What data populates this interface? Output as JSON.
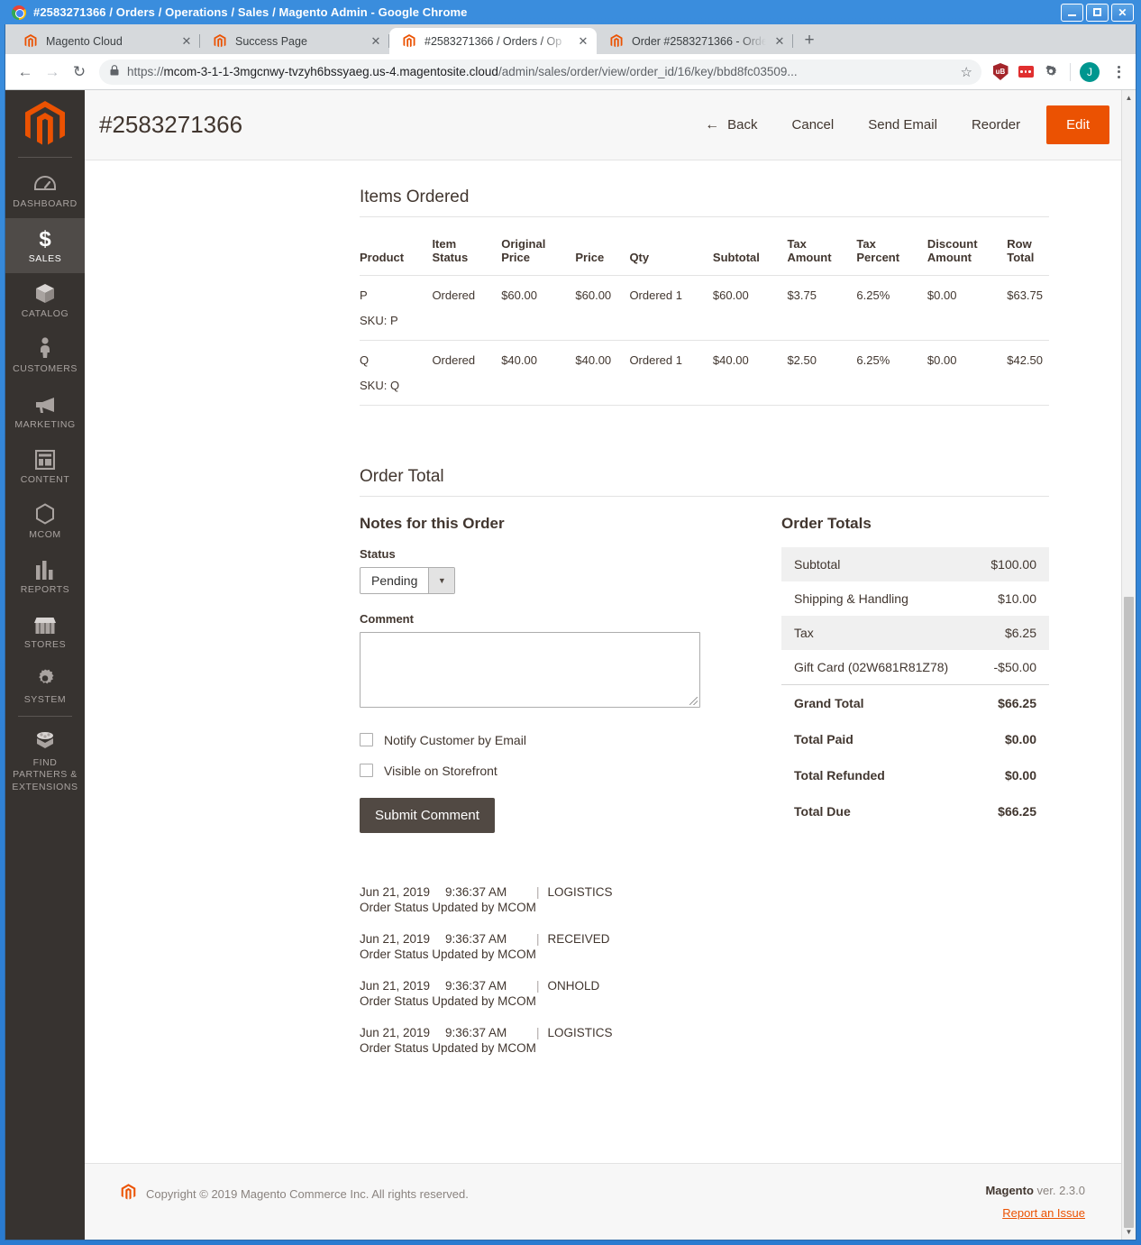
{
  "window": {
    "title": "#2583271366 / Orders / Operations / Sales / Magento Admin - Google Chrome",
    "minimize_label": "Minimize",
    "maximize_label": "Maximize",
    "close_label": "Close"
  },
  "browser": {
    "tabs": [
      {
        "label": "Magento Cloud",
        "close": "✕",
        "active": false
      },
      {
        "label": "Success Page",
        "close": "✕",
        "active": false
      },
      {
        "label": "#2583271366 / Orders / Op",
        "close": "✕",
        "active": true
      },
      {
        "label": "Order #2583271366 - Orde",
        "close": "✕",
        "active": false
      }
    ],
    "new_tab": "+",
    "back": "←",
    "forward": "→",
    "reload": "↻",
    "lock": "🔒",
    "url_scheme": "https://",
    "url_host": "mcom-3-1-1-3mgcnwy-tvzyh6bssyaeg.us-4.magentosite.cloud",
    "url_path": "/admin/sales/order/view/order_id/16/key/bbd8fc03509...",
    "star": "☆",
    "ublock_label": "uB",
    "avatar_initial": "J"
  },
  "sidebar": {
    "logo_name": "magento-logo",
    "items": [
      {
        "label": "DASHBOARD",
        "icon": "dashboard-icon",
        "active": false
      },
      {
        "label": "SALES",
        "icon": "dollar-icon",
        "active": true
      },
      {
        "label": "CATALOG",
        "icon": "box-icon",
        "active": false
      },
      {
        "label": "CUSTOMERS",
        "icon": "person-icon",
        "active": false
      },
      {
        "label": "MARKETING",
        "icon": "megaphone-icon",
        "active": false
      },
      {
        "label": "CONTENT",
        "icon": "layout-icon",
        "active": false
      },
      {
        "label": "MCOM",
        "icon": "hexagon-icon",
        "active": false
      },
      {
        "label": "REPORTS",
        "icon": "bar-chart-icon",
        "active": false
      },
      {
        "label": "STORES",
        "icon": "store-icon",
        "active": false
      },
      {
        "label": "SYSTEM",
        "icon": "gear-icon",
        "active": false
      },
      {
        "label": "FIND PARTNERS & EXTENSIONS",
        "icon": "extension-icon",
        "active": false
      }
    ]
  },
  "page": {
    "title": "#2583271366",
    "actions": {
      "back": "Back",
      "back_arrow": "←",
      "cancel": "Cancel",
      "send_email": "Send Email",
      "reorder": "Reorder",
      "edit": "Edit"
    }
  },
  "items_ordered": {
    "title": "Items Ordered",
    "columns": [
      "Product",
      "Item Status",
      "Original Price",
      "Price",
      "Qty",
      "Subtotal",
      "Tax Amount",
      "Tax Percent",
      "Discount Amount",
      "Row Total"
    ],
    "rows": [
      {
        "product": "P",
        "sku": "SKU: P",
        "item_status": "Ordered",
        "original_price": "$60.00",
        "price": "$60.00",
        "qty": "Ordered 1",
        "subtotal": "$60.00",
        "tax_amount": "$3.75",
        "tax_percent": "6.25%",
        "discount_amount": "$0.00",
        "row_total": "$63.75"
      },
      {
        "product": "Q",
        "sku": "SKU: Q",
        "item_status": "Ordered",
        "original_price": "$40.00",
        "price": "$40.00",
        "qty": "Ordered 1",
        "subtotal": "$40.00",
        "tax_amount": "$2.50",
        "tax_percent": "6.25%",
        "discount_amount": "$0.00",
        "row_total": "$42.50"
      }
    ]
  },
  "order_total": {
    "title": "Order Total",
    "notes": {
      "title": "Notes for this Order",
      "status_label": "Status",
      "status_value": "Pending",
      "status_arrow": "▼",
      "comment_label": "Comment",
      "comment_value": "",
      "comment_placeholder": "",
      "notify_label": "Notify Customer by Email",
      "visible_label": "Visible on Storefront",
      "submit_label": "Submit Comment"
    },
    "totals": {
      "title": "Order Totals",
      "rows": [
        {
          "label": "Subtotal",
          "amount": "$100.00",
          "shade": true,
          "strong": false
        },
        {
          "label": "Shipping & Handling",
          "amount": "$10.00",
          "shade": false,
          "strong": false
        },
        {
          "label": "Tax",
          "amount": "$6.25",
          "shade": true,
          "strong": false
        },
        {
          "label": "Gift Card (02W681R81Z78)",
          "amount": "-$50.00",
          "shade": false,
          "strong": false
        },
        {
          "label": "Grand Total",
          "amount": "$66.25",
          "shade": false,
          "strong": true
        },
        {
          "label": "Total Paid",
          "amount": "$0.00",
          "shade": false,
          "strong": true
        },
        {
          "label": "Total Refunded",
          "amount": "$0.00",
          "shade": false,
          "strong": true
        },
        {
          "label": "Total Due",
          "amount": "$66.25",
          "shade": false,
          "strong": true
        }
      ]
    }
  },
  "history": [
    {
      "date": "Jun 21, 2019",
      "time": "9:36:37 AM",
      "sep": "|",
      "status": "LOGISTICS",
      "note": "Order Status Updated by MCOM"
    },
    {
      "date": "Jun 21, 2019",
      "time": "9:36:37 AM",
      "sep": "|",
      "status": "RECEIVED",
      "note": "Order Status Updated by MCOM"
    },
    {
      "date": "Jun 21, 2019",
      "time": "9:36:37 AM",
      "sep": "|",
      "status": "ONHOLD",
      "note": "Order Status Updated by MCOM"
    },
    {
      "date": "Jun 21, 2019",
      "time": "9:36:37 AM",
      "sep": "|",
      "status": "LOGISTICS",
      "note": "Order Status Updated by MCOM"
    }
  ],
  "footer": {
    "copyright": "Copyright © 2019 Magento Commerce Inc. All rights reserved.",
    "brand": "Magento",
    "version": " ver. 2.3.0",
    "report_link": "Report an Issue"
  },
  "scrollbar": {
    "up_arrow": "▲",
    "down_arrow": "▼"
  },
  "colors": {
    "accent_orange": "#eb5202",
    "sidebar_bg": "#373330",
    "sidebar_active": "#4f4b48",
    "text_dark": "#41362f",
    "submit_btn": "#514943",
    "chrome_blue": "#2a7bd0"
  }
}
